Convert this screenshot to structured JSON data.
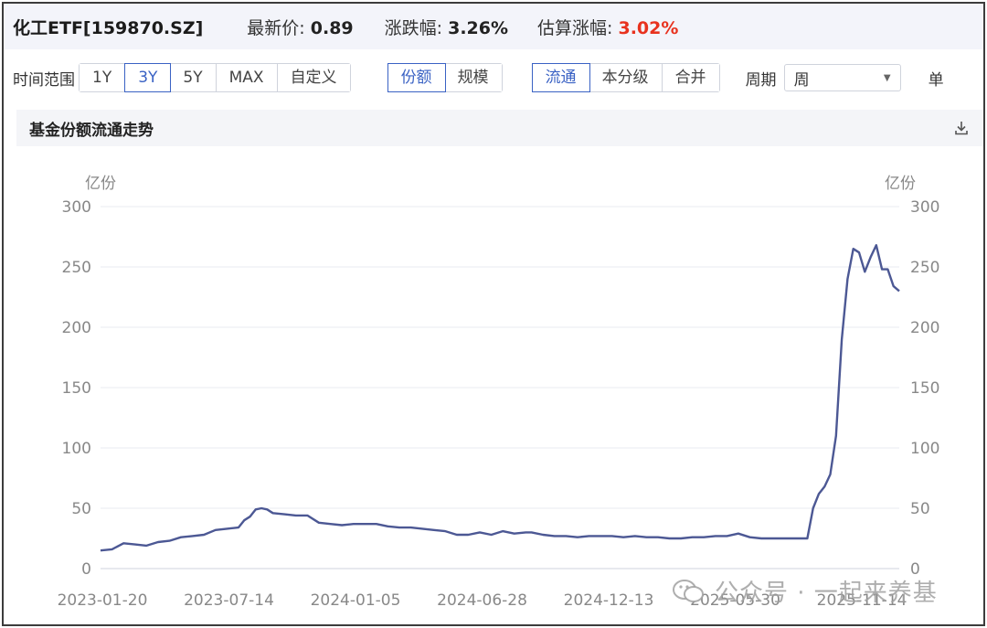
{
  "header": {
    "fund_name": "化工ETF[159870.SZ]",
    "latest_price_label": "最新价:",
    "latest_price_value": "0.89",
    "change_label": "涨跌幅:",
    "change_value": "3.26%",
    "est_change_label": "估算涨幅:",
    "est_change_value": "3.02%"
  },
  "controls": {
    "range_label": "时间范围",
    "range_buttons": [
      "1Y",
      "3Y",
      "5Y",
      "MAX",
      "自定义"
    ],
    "range_active": "3Y",
    "metric_buttons": [
      "份额",
      "规模"
    ],
    "metric_active": "份额",
    "scope_buttons": [
      "流通",
      "本分级",
      "合并"
    ],
    "scope_active": "流通",
    "period_label": "周期",
    "period_value": "周",
    "truncated_label": "单"
  },
  "panel": {
    "title": "基金份额流通走势",
    "download_icon": "download-icon"
  },
  "colors": {
    "line": "#4c5894",
    "active": "#3a62c4",
    "red": "#e8321e",
    "grid": "#e9ebf0"
  },
  "chart_data": {
    "type": "line",
    "ylabel_left": "亿份",
    "ylabel_right": "亿份",
    "ylim": [
      0,
      300
    ],
    "yticks": [
      0,
      50,
      100,
      150,
      200,
      250,
      300
    ],
    "xlim": [
      "2023-01-20",
      "2025-09-19"
    ],
    "xtick_labels": [
      "2023-01-20",
      "2023-07-14",
      "2024-01-05",
      "2024-06-28",
      "2024-12-13",
      "2025-05-30",
      "2025-11-14"
    ],
    "grid": true,
    "series": [
      {
        "values": [
          [
            "2023-01-20",
            15
          ],
          [
            "2023-02-03",
            16
          ],
          [
            "2023-02-17",
            21
          ],
          [
            "2023-03-03",
            20
          ],
          [
            "2023-03-17",
            19
          ],
          [
            "2023-03-31",
            22
          ],
          [
            "2023-04-14",
            23
          ],
          [
            "2023-04-28",
            26
          ],
          [
            "2023-05-12",
            27
          ],
          [
            "2023-05-26",
            28
          ],
          [
            "2023-06-09",
            32
          ],
          [
            "2023-06-23",
            33
          ],
          [
            "2023-07-07",
            34
          ],
          [
            "2023-07-14",
            40
          ],
          [
            "2023-07-21",
            43
          ],
          [
            "2023-07-28",
            49
          ],
          [
            "2023-08-04",
            50
          ],
          [
            "2023-08-11",
            49
          ],
          [
            "2023-08-18",
            46
          ],
          [
            "2023-09-01",
            45
          ],
          [
            "2023-09-15",
            44
          ],
          [
            "2023-09-29",
            44
          ],
          [
            "2023-10-13",
            38
          ],
          [
            "2023-10-27",
            37
          ],
          [
            "2023-11-10",
            36
          ],
          [
            "2023-11-24",
            37
          ],
          [
            "2023-12-08",
            37
          ],
          [
            "2023-12-22",
            37
          ],
          [
            "2024-01-05",
            35
          ],
          [
            "2024-01-19",
            34
          ],
          [
            "2024-02-02",
            34
          ],
          [
            "2024-02-16",
            33
          ],
          [
            "2024-03-01",
            32
          ],
          [
            "2024-03-15",
            31
          ],
          [
            "2024-03-29",
            28
          ],
          [
            "2024-04-12",
            28
          ],
          [
            "2024-04-26",
            30
          ],
          [
            "2024-05-10",
            28
          ],
          [
            "2024-05-24",
            31
          ],
          [
            "2024-06-07",
            29
          ],
          [
            "2024-06-21",
            30
          ],
          [
            "2024-06-28",
            30
          ],
          [
            "2024-07-12",
            28
          ],
          [
            "2024-07-26",
            27
          ],
          [
            "2024-08-09",
            27
          ],
          [
            "2024-08-23",
            26
          ],
          [
            "2024-09-06",
            27
          ],
          [
            "2024-09-20",
            27
          ],
          [
            "2024-10-04",
            27
          ],
          [
            "2024-10-18",
            26
          ],
          [
            "2024-11-01",
            27
          ],
          [
            "2024-11-15",
            26
          ],
          [
            "2024-11-29",
            26
          ],
          [
            "2024-12-13",
            25
          ],
          [
            "2024-12-27",
            25
          ],
          [
            "2025-01-10",
            26
          ],
          [
            "2025-01-24",
            26
          ],
          [
            "2025-02-07",
            27
          ],
          [
            "2025-02-21",
            27
          ],
          [
            "2025-03-07",
            29
          ],
          [
            "2025-03-21",
            26
          ],
          [
            "2025-04-04",
            25
          ],
          [
            "2025-04-18",
            25
          ],
          [
            "2025-05-02",
            25
          ],
          [
            "2025-05-16",
            25
          ],
          [
            "2025-05-30",
            25
          ],
          [
            "2025-06-06",
            50
          ],
          [
            "2025-06-13",
            62
          ],
          [
            "2025-06-20",
            68
          ],
          [
            "2025-06-27",
            78
          ],
          [
            "2025-07-04",
            110
          ],
          [
            "2025-07-11",
            190
          ],
          [
            "2025-07-18",
            240
          ],
          [
            "2025-07-25",
            265
          ],
          [
            "2025-08-01",
            262
          ],
          [
            "2025-08-08",
            246
          ],
          [
            "2025-08-15",
            258
          ],
          [
            "2025-08-22",
            268
          ],
          [
            "2025-08-29",
            248
          ],
          [
            "2025-09-05",
            248
          ],
          [
            "2025-09-12",
            234
          ],
          [
            "2025-09-19",
            230
          ]
        ]
      }
    ]
  },
  "watermark": {
    "text": "公众号 · 一起来养基"
  }
}
